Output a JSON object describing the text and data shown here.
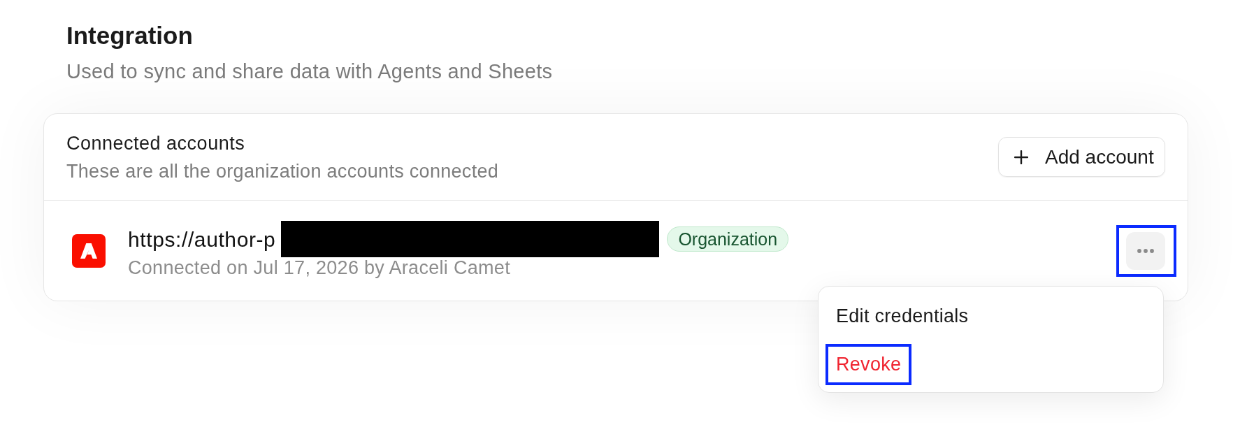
{
  "page": {
    "title": "Integration",
    "subtitle": "Used to sync and share data with Agents and Sheets"
  },
  "connected_accounts": {
    "title": "Connected accounts",
    "description": "These are all the organization accounts connected",
    "add_button": {
      "label": "Add account"
    },
    "accounts": [
      {
        "url": "https://author-p",
        "redacted": true,
        "badge": "Organization",
        "connected": "Connected on Jul 17, 2026 by Araceli Camet",
        "menu_button": {
          "highlighted": true
        },
        "menu": {
          "open": true,
          "items": [
            {
              "label": "Edit credentials",
              "kind": "default",
              "highlighted": false
            },
            {
              "label": "Revoke",
              "kind": "danger",
              "highlighted": true
            }
          ]
        }
      }
    ]
  }
}
